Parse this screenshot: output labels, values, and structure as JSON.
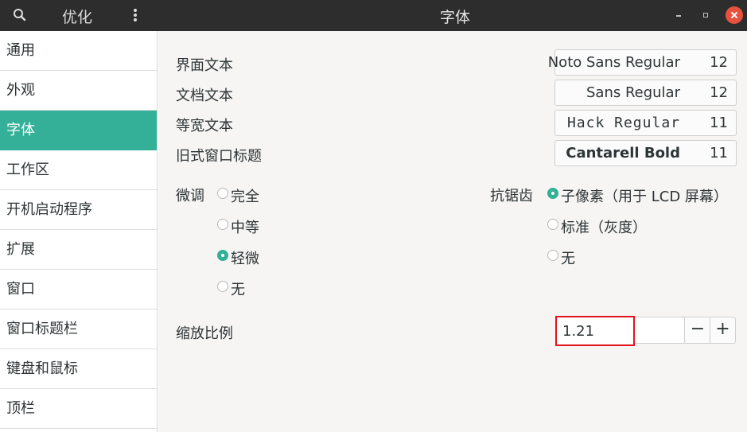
{
  "header": {
    "app_title": "优化",
    "page_title": "字体",
    "icons": {
      "search": "search-icon",
      "menu": "kebab-menu-icon",
      "minimize": "minimize-icon",
      "maximize": "maximize-icon",
      "close": "close-icon"
    },
    "close_color": "#e8513e"
  },
  "sidebar": {
    "active_color": "#33b097",
    "items": [
      {
        "label": "通用"
      },
      {
        "label": "外观"
      },
      {
        "label": "字体"
      },
      {
        "label": "工作区"
      },
      {
        "label": "开机启动程序"
      },
      {
        "label": "扩展"
      },
      {
        "label": "窗口"
      },
      {
        "label": "窗口标题栏"
      },
      {
        "label": "键盘和鼠标"
      },
      {
        "label": "顶栏"
      }
    ]
  },
  "fonts": [
    {
      "label": "界面文本",
      "font": "Noto Sans Regular",
      "size": "12"
    },
    {
      "label": "文档文本",
      "font": "Sans Regular",
      "size": "12"
    },
    {
      "label": "等宽文本",
      "font": "Hack Regular",
      "size": "11"
    },
    {
      "label": "旧式窗口标题",
      "font": "Cantarell Bold",
      "size": "11"
    }
  ],
  "hinting": {
    "label": "微调",
    "options": [
      "完全",
      "中等",
      "轻微",
      "无"
    ],
    "selected": "轻微"
  },
  "antialiasing": {
    "label": "抗锯齿",
    "options": [
      "子像素（用于 LCD 屏幕）",
      "标准（灰度）",
      "无"
    ],
    "selected": "子像素（用于 LCD 屏幕）"
  },
  "scaling": {
    "label": "缩放比例",
    "value": "1.21",
    "minus": "−",
    "plus": "+"
  }
}
